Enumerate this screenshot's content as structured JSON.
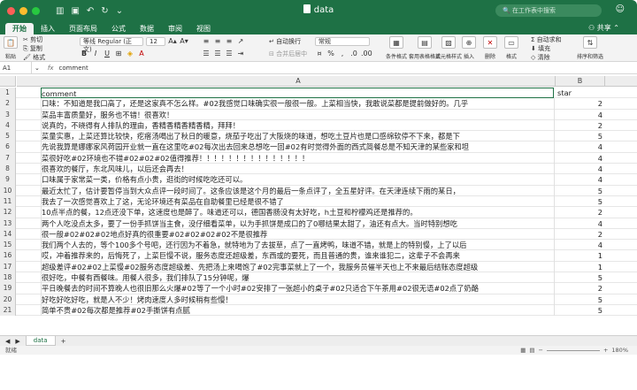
{
  "window": {
    "title": "data",
    "search_placeholder": "在工作表中搜索",
    "share_label": "共享"
  },
  "tabs": [
    "开始",
    "插入",
    "页面布局",
    "公式",
    "数据",
    "审阅",
    "视图"
  ],
  "ribbon": {
    "paste": "粘贴",
    "cut": "剪切",
    "copy": "复制",
    "format_painter": "格式",
    "font_name": "等线 Regular (正文)",
    "font_size": "12",
    "wrap_text": "自动换行",
    "merge_center": "合并后居中",
    "number_format": "常规",
    "percent": "%",
    "conditional": "条件格式",
    "table_format": "套用表格格式",
    "cell_style": "单元格样式",
    "insert": "插入",
    "delete": "删除",
    "format": "格式",
    "autosum": "自动求和",
    "fill": "填充",
    "clear": "清除",
    "sort_filter": "排序和筛选"
  },
  "formula_bar": {
    "cell_ref": "A1",
    "fx": "fx",
    "value": "comment"
  },
  "columns": {
    "a": "A",
    "b": "B"
  },
  "rows": [
    {
      "n": "1",
      "comment": "comment",
      "star": "star"
    },
    {
      "n": "2",
      "comment": "口味：不知道是我口高了，还是这家真不怎么样。#02我感觉口味确实很一般很一般。上菜相当快，我敢说菜都是提前做好的。几乎",
      "star": "2"
    },
    {
      "n": "3",
      "comment": "菜品丰富质量好，服务也不错！很喜欢！",
      "star": "4"
    },
    {
      "n": "4",
      "comment": "说真的，不晓得有人排队的理由，香精香精香精香精，拜拜！",
      "star": "2"
    },
    {
      "n": "5",
      "comment": "菜量实惠，上菜还算比较快，疙瘩汤喝出了秋日的暖意，烧茄子吃出了大阪烧的味道，想吃土豆片也是口感绵软停不下来，都是下",
      "star": "5"
    },
    {
      "n": "6",
      "comment": "先说我算是娜娜家风荷园开业就一直在这里吃#02每次出去回来总想吃一回#02有时觉得外面的西式简餐总是不知天津的某些家和坦",
      "star": "4"
    },
    {
      "n": "7",
      "comment": "菜很好吃#02环境也不错#02#02#02值得推荐！！！！！！！！！！！！！！！",
      "star": "4"
    },
    {
      "n": "8",
      "comment": "很喜欢的餐厅，东北风味儿，以后还会再去！",
      "star": "4"
    },
    {
      "n": "9",
      "comment": "口味属于家常菜一类，价格有点小贵，逛街的时候吃吃还可以。",
      "star": "4"
    },
    {
      "n": "10",
      "comment": "最近太忙了，估计要暂停当到大众点评一段时间了。这条应该是这个月的最后一条点评了，全五星好评。在天津连续下雨的某日，",
      "star": "5"
    },
    {
      "n": "11",
      "comment": "我去了一次感觉喜欢上了这，无论环境还有菜品在自助餐里已经是很不错了",
      "star": "5"
    },
    {
      "n": "12",
      "comment": "10点半点的餐，12点还没下单，这速度也是醉了。味道还可以，德国香肠没有太好吃，h土豆和柠檬鸡还是推荐的。",
      "star": "2"
    },
    {
      "n": "13",
      "comment": "两个人吃没点太多，要了一份手抓饼当主食，没仔细看菜单，以为手抓饼是成口的了0哪结果太甜了，油还有点大。当时特别想吃",
      "star": "4"
    },
    {
      "n": "14",
      "comment": "很一般#02#02#02地点好真的很重要#02#02#02#02不是很推荐",
      "star": "2"
    },
    {
      "n": "15",
      "comment": "我们两个人去的，等个100多个号吧，还行因为不着急，就特地为了去拔草，点了一直烤鸭，味道不错，就是上的特别慢，上了以后",
      "star": "4"
    },
    {
      "n": "16",
      "comment": "哎，冲着推荐来的，后悔死了，上菜巨慢不说，服务态度还超级差，东西或的要死，而且普通的贵，谁来谁犯二，这辈子不会再来",
      "star": "1"
    },
    {
      "n": "17",
      "comment": "超级差评#02#02上菜慢#02服务态度超级差、先把汤上来喝饱了#02完事菜就上了一个，我服务员催半天也上不来最后结账态度超级",
      "star": "1"
    },
    {
      "n": "18",
      "comment": "很好吃，中餐有西餐味。用餐人很多，我们排队了15分钟呢，爆",
      "star": "5"
    },
    {
      "n": "19",
      "comment": "平日晚餐去的时间不算晚人也很旧那么火爆#02等了一个小时#02安排了一张超小的桌子#02只适合下午茶用#02很无语#02点了奶酪",
      "star": "2"
    },
    {
      "n": "20",
      "comment": "好吃好吃好吃，就是人不少！烤肉速度人多时候稍有些慢！",
      "star": "5"
    },
    {
      "n": "21",
      "comment": "简单不贵#02每次都是推荐#02手撕饼有点腻",
      "star": "5"
    }
  ],
  "sheet_tabs": [
    "data"
  ],
  "status": {
    "mode": "就绪",
    "zoom": "180%"
  }
}
